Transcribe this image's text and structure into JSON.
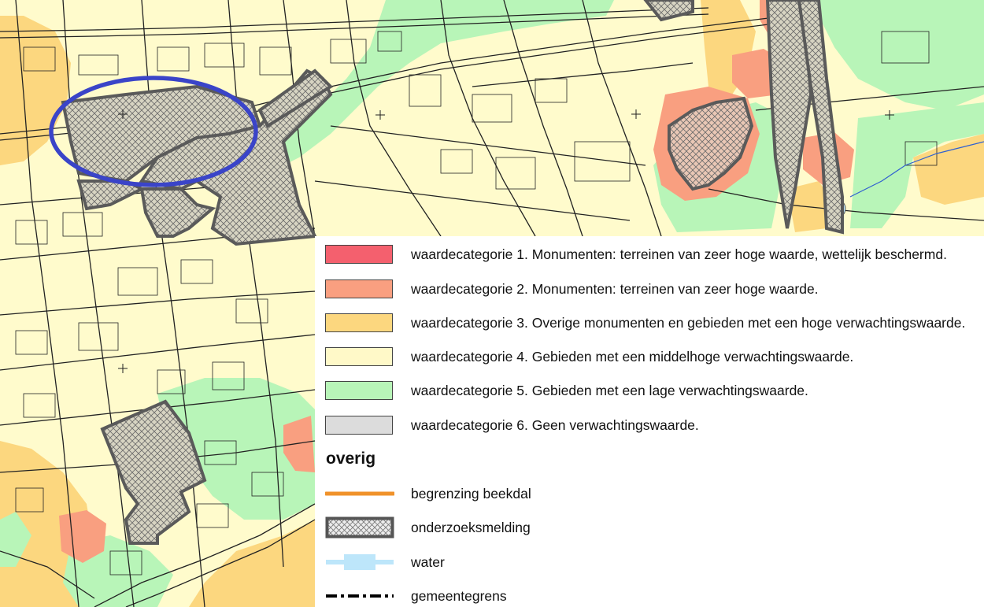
{
  "legend": {
    "categories": [
      {
        "label": "waardecategorie 1. Monumenten: terreinen van zeer hoge waarde, wettelijk beschermd.",
        "color": "#f4606e"
      },
      {
        "label": "waardecategorie 2. Monumenten: terreinen van zeer hoge waarde.",
        "color": "#f99f80"
      },
      {
        "label": "waardecategorie 3. Overige monumenten en gebieden met een hoge verwachtingswaarde.",
        "color": "#fcd77f"
      },
      {
        "label": "waardecategorie 4. Gebieden met een middelhoge verwachtingswaarde.",
        "color": "#fff9c8"
      },
      {
        "label": "waardecategorie 5. Gebieden met een lage verwachtingswaarde.",
        "color": "#b8f5b8"
      },
      {
        "label": "waardecategorie 6. Geen verwachtingswaarde.",
        "color": "#dcdcdc"
      }
    ],
    "overig_title": "overig",
    "overig": [
      {
        "label": "begrenzing beekdal",
        "icon": "orange-line-icon",
        "color": "#f0922a"
      },
      {
        "label": "onderzoeksmelding",
        "icon": "crosshatch-box-icon",
        "color": "#555555"
      },
      {
        "label": "water",
        "icon": "water-icon",
        "color": "#bde6fa"
      },
      {
        "label": "gemeentegrens",
        "icon": "dash-dot-line-icon",
        "color": "#000000"
      }
    ]
  },
  "map": {
    "colors": {
      "background": "#fffbcc",
      "zone_low": "#b8f5b8",
      "zone_high": "#fcd77f",
      "zone_cat2": "#f99f80",
      "road": "#222222",
      "highlight_ellipse": "#3a44c8",
      "research_border": "#5a5a5a"
    }
  }
}
